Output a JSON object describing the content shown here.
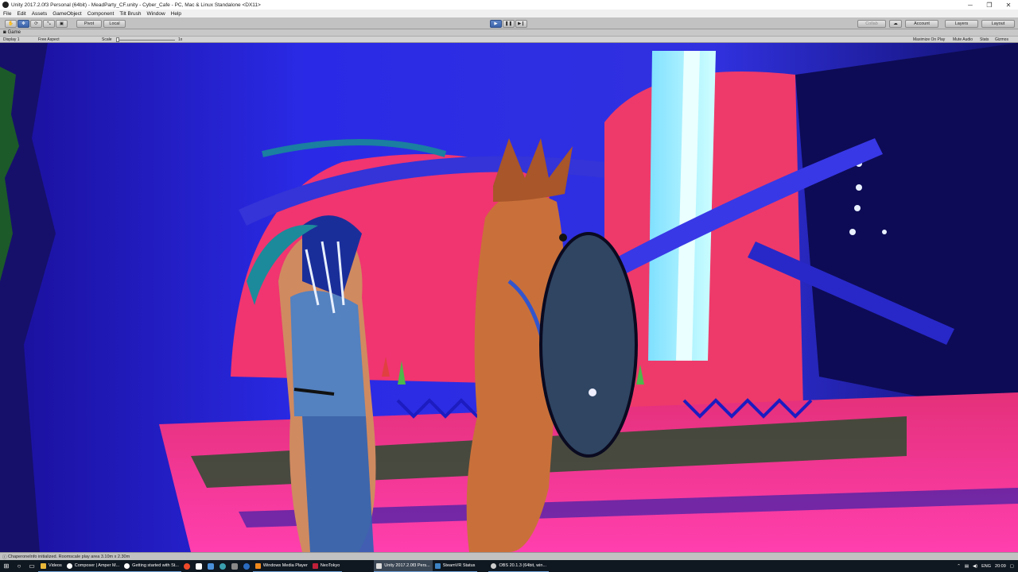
{
  "window": {
    "title": "Unity 2017.2.0f3 Personal (64bit) - MeadParty_CF.unity - Cyber_Cafe - PC, Mac & Linux Standalone <DX11>",
    "minimize": "─",
    "maximize": "❐",
    "close": "✕"
  },
  "menu": [
    "File",
    "Edit",
    "Assets",
    "GameObject",
    "Component",
    "Tilt Brush",
    "Window",
    "Help"
  ],
  "toolbar": {
    "pivot_label": "Pivot",
    "local_label": "Local",
    "collab_label": "Collab",
    "account_label": "Account",
    "layers_label": "Layers",
    "layout_label": "Layout"
  },
  "game_view": {
    "tab_label": "Game",
    "display_label": "Display 1",
    "aspect_label": "Free Aspect",
    "scale_label": "Scale",
    "scale_value": "1x",
    "maximize_label": "Maximize On Play",
    "mute_label": "Mute Audio",
    "stats_label": "Stats",
    "gizmos_label": "Gizmos"
  },
  "status_text": "ChaperoneInfo initialized. Roomscale play area 3.10m x 2.30m",
  "taskbar": {
    "items": [
      {
        "label": "Videos",
        "color": "#e9b83a"
      },
      {
        "label": "Composer | Amper M...",
        "color": "#ffffff"
      },
      {
        "label": "Getting started with St...",
        "color": "#ffffff"
      },
      {
        "label": "Windows Media Player",
        "color": "#f08a1c"
      },
      {
        "label": "NeoTokyo",
        "color": "#c0203a"
      },
      {
        "label": "Unity 2017.2.0f3 Pers...",
        "color": "#dddddd"
      },
      {
        "label": "SteamVR Status",
        "color": "#3d83c5"
      },
      {
        "label": "OBS 20.1.3 (64bit, win...",
        "color": "#cccccc"
      }
    ],
    "language": "ENG",
    "time": "20:09"
  }
}
